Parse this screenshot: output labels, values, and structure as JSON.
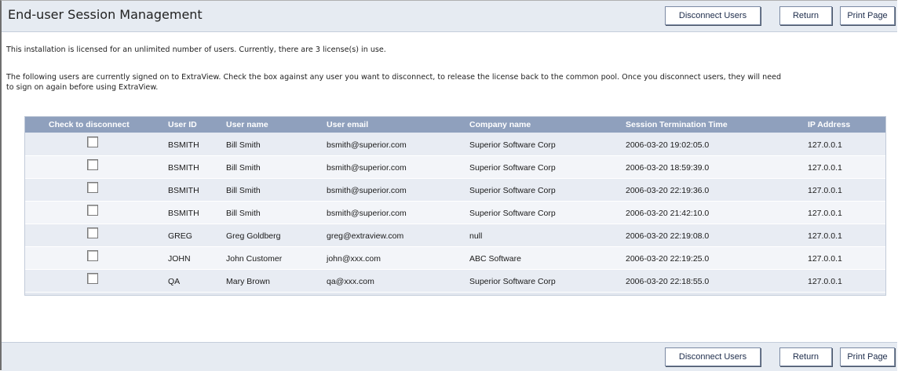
{
  "page": {
    "title": "End-user Session Management"
  },
  "toolbar": {
    "disconnect_label": "Disconnect Users",
    "return_label": "Return",
    "print_label": "Print Page"
  },
  "intro": {
    "license_text": "This installation is licensed for an unlimited number of users. Currently, there are 3 license(s) in use.",
    "instructions_line1": "The following users are currently signed on to ExtraView. Check the box against any user you want to disconnect, to release the license back to the common pool. Once you disconnect users, they will need",
    "instructions_line2": "to sign on again before using ExtraView."
  },
  "table": {
    "headers": {
      "check": "Check to disconnect",
      "user_id": "User ID",
      "user_name": "User name",
      "user_email": "User email",
      "company": "Company name",
      "session_end": "Session Termination Time",
      "ip": "IP Address"
    },
    "rows": [
      {
        "user_id": "BSMITH",
        "user_name": "Bill Smith",
        "user_email": "bsmith@superior.com",
        "company": "Superior Software Corp",
        "session_end": "2006-03-20 19:02:05.0",
        "ip": "127.0.0.1",
        "checked": false
      },
      {
        "user_id": "BSMITH",
        "user_name": "Bill Smith",
        "user_email": "bsmith@superior.com",
        "company": "Superior Software Corp",
        "session_end": "2006-03-20 18:59:39.0",
        "ip": "127.0.0.1",
        "checked": false
      },
      {
        "user_id": "BSMITH",
        "user_name": "Bill Smith",
        "user_email": "bsmith@superior.com",
        "company": "Superior Software Corp",
        "session_end": "2006-03-20 22:19:36.0",
        "ip": "127.0.0.1",
        "checked": false
      },
      {
        "user_id": "BSMITH",
        "user_name": "Bill Smith",
        "user_email": "bsmith@superior.com",
        "company": "Superior Software Corp",
        "session_end": "2006-03-20 21:42:10.0",
        "ip": "127.0.0.1",
        "checked": false
      },
      {
        "user_id": "GREG",
        "user_name": "Greg Goldberg",
        "user_email": "greg@extraview.com",
        "company": "null",
        "session_end": "2006-03-20 22:19:08.0",
        "ip": "127.0.0.1",
        "checked": false
      },
      {
        "user_id": "JOHN",
        "user_name": "John Customer",
        "user_email": "john@xxx.com",
        "company": "ABC Software",
        "session_end": "2006-03-20 22:19:25.0",
        "ip": "127.0.0.1",
        "checked": false
      },
      {
        "user_id": "QA",
        "user_name": "Mary Brown",
        "user_email": "qa@xxx.com",
        "company": "Superior Software Corp",
        "session_end": "2006-03-20 22:18:55.0",
        "ip": "127.0.0.1",
        "checked": false
      }
    ]
  }
}
